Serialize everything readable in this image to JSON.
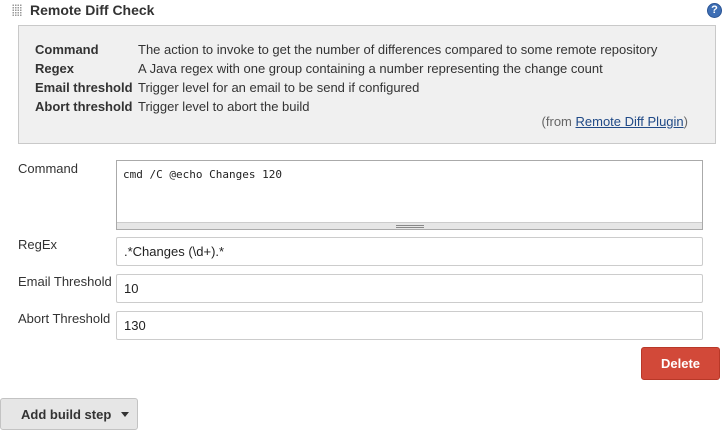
{
  "section": {
    "title": "Remote Diff Check",
    "help_icon_glyph": "?"
  },
  "help": {
    "entries": [
      {
        "term": "Command",
        "description": "The action to invoke to get the number of differences compared to some remote repository"
      },
      {
        "term": "Regex",
        "description": "A Java regex with one group containing a number representing the change count"
      },
      {
        "term": "Email threshold",
        "description": "Trigger level for an email to be send if configured"
      },
      {
        "term": "Abort threshold",
        "description": "Trigger level to abort the build"
      }
    ],
    "from_prefix": "(from ",
    "plugin_link": "Remote Diff Plugin",
    "from_suffix": ")"
  },
  "form": {
    "command": {
      "label": "Command",
      "value": "cmd /C @echo Changes 120"
    },
    "regex": {
      "label": "RegEx",
      "value": ".*Changes (\\d+).*"
    },
    "email_threshold": {
      "label": "Email Threshold",
      "value": "10"
    },
    "abort_threshold": {
      "label": "Abort Threshold",
      "value": "130"
    }
  },
  "buttons": {
    "delete": "Delete",
    "add_build_step": "Add build step"
  },
  "colors": {
    "delete_button": "#d24939",
    "help_icon": "#3e6fb5",
    "help_background": "#f0f0f0",
    "link": "#204a87"
  },
  "icons": {
    "drag_handle": "drag-handle-icon",
    "help": "help-icon",
    "dropdown": "caret-down-icon"
  }
}
